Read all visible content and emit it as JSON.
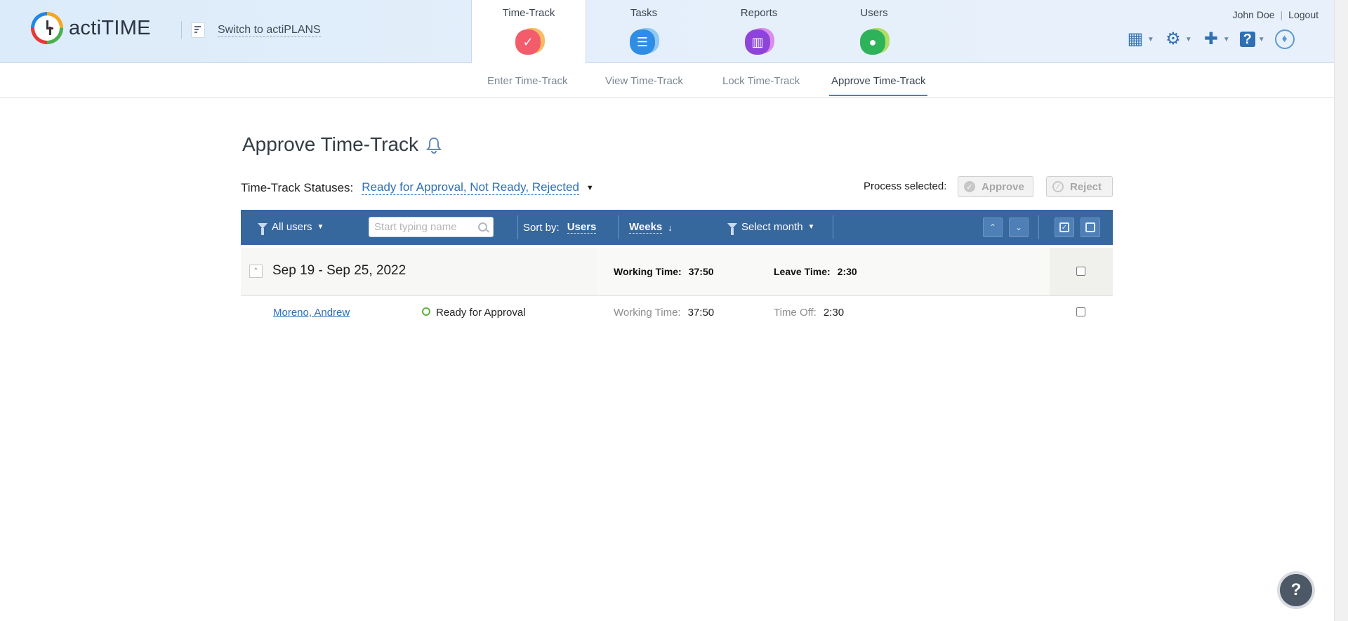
{
  "app": {
    "brand": "actiTIME",
    "switch_label": "Switch to actiPLANS"
  },
  "main_tabs": [
    {
      "label": "Time-Track",
      "icon": "checkmark-icon",
      "color": "#f25c6b"
    },
    {
      "label": "Tasks",
      "icon": "list-icon",
      "color": "#2f8de4"
    },
    {
      "label": "Reports",
      "icon": "bar-chart-icon",
      "color": "#8e44d9"
    },
    {
      "label": "Users",
      "icon": "user-icon",
      "color": "#2eb35a"
    }
  ],
  "user": {
    "name": "John Doe",
    "logout": "Logout"
  },
  "sub_tabs": [
    {
      "label": "Enter Time-Track"
    },
    {
      "label": "View Time-Track"
    },
    {
      "label": "Lock Time-Track"
    },
    {
      "label": "Approve Time-Track"
    }
  ],
  "page": {
    "title": "Approve Time-Track",
    "statuses_label": "Time-Track Statuses:",
    "statuses_value": "Ready for Approval, Not Ready, Rejected",
    "process_label": "Process selected:",
    "approve_label": "Approve",
    "reject_label": "Reject"
  },
  "toolbar": {
    "users_filter": "All users",
    "search_placeholder": "Start typing name",
    "sort_label": "Sort by:",
    "sort_users": "Users",
    "sort_weeks": "Weeks",
    "month_filter": "Select month"
  },
  "group": {
    "week": "Sep 19 - Sep 25, 2022",
    "working_time_label": "Working Time:",
    "working_time_value": "37:50",
    "leave_time_label": "Leave Time:",
    "leave_time_value": "2:30"
  },
  "rows": [
    {
      "user": "Moreno, Andrew",
      "status": "Ready for Approval",
      "status_color": "#5db13e",
      "working_time_label": "Working Time:",
      "working_time_value": "37:50",
      "time_off_label": "Time Off:",
      "time_off_value": "2:30"
    }
  ],
  "help": {
    "label": "?"
  },
  "colors": {
    "toolbar_bg": "#36679d",
    "link": "#2f6fb3",
    "accent_underline": "#3d84c6"
  }
}
